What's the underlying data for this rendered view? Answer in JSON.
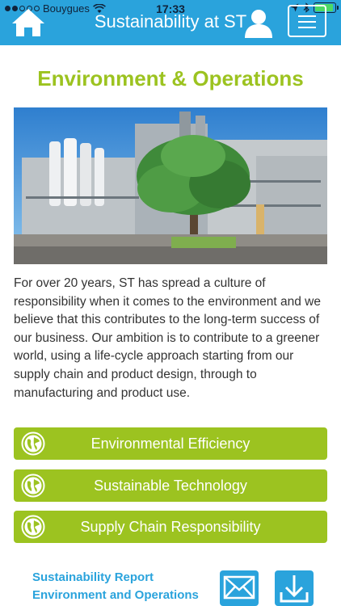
{
  "status_bar": {
    "carrier": "Bouygues",
    "time": "17:33",
    "signal_bars_filled": 2,
    "signal_bars_total": 5,
    "battery_level": 0.9,
    "icons": [
      "wifi-icon",
      "location-arrow-icon",
      "bluetooth-icon",
      "battery-icon"
    ]
  },
  "header": {
    "title": "Sustainability at ST",
    "icons": [
      "home-icon",
      "user-icon",
      "menu-icon"
    ]
  },
  "page": {
    "title": "Environment & Operations",
    "hero_image": "industrial-plant-photo",
    "intro": "For over 20 years, ST has spread a culture of responsibility when it comes to the environment and we believe that this contributes to the long-term success of our business. Our ambition is to contribute to a greener world, using a life-cycle approach starting from our supply chain and product design, through to manufacturing and product use."
  },
  "buttons": [
    {
      "label": "Environmental Efficiency",
      "icon": "globe-icon"
    },
    {
      "label": "Sustainable Technology",
      "icon": "globe-icon"
    },
    {
      "label": "Supply Chain Responsibility",
      "icon": "globe-icon"
    }
  ],
  "footer": {
    "report_line_1": "Sustainability Report",
    "report_line_2": "Environment and Operations",
    "icons": [
      "mail-icon",
      "download-icon"
    ]
  },
  "colors": {
    "primary_blue": "#2aa3dc",
    "accent_green": "#9cc320",
    "text": "#333333"
  }
}
